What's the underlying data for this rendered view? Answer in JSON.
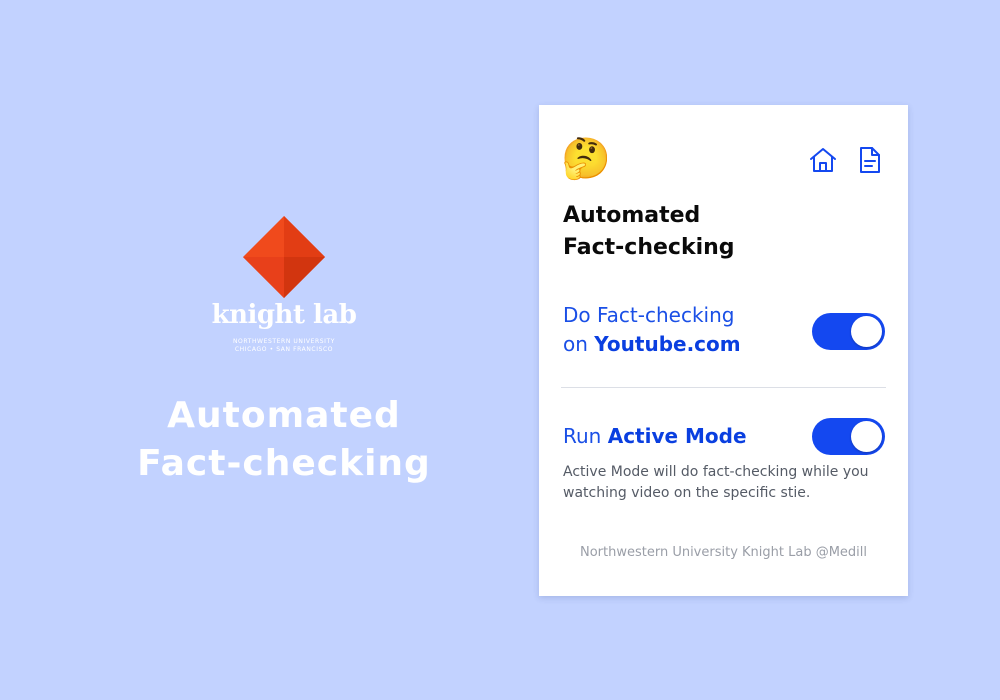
{
  "branding": {
    "logo_name": "knight lab",
    "logo_line1": "NORTHWESTERN UNIVERSITY",
    "logo_line2": "CHICAGO • SAN FRANCISCO",
    "hero_title_line1": "Automated",
    "hero_title_line2": "Fact-checking",
    "logo_color": "#e8401a"
  },
  "popup": {
    "emoji": "🤔",
    "icons": [
      "home-icon",
      "document-icon"
    ],
    "title_line1": "Automated",
    "title_line2": "Fact-checking",
    "setting1": {
      "label_prefix": "Do Fact-checking",
      "label_on": "on ",
      "label_bold": "Youtube.com",
      "enabled": true
    },
    "setting2": {
      "label_prefix": "Run ",
      "label_bold": "Active Mode",
      "enabled": true,
      "description": "Active Mode will do fact-checking while you watching video on the specific stie."
    },
    "footer": "Northwestern University Knight Lab @Medill",
    "accent_color": "#1448f0"
  }
}
